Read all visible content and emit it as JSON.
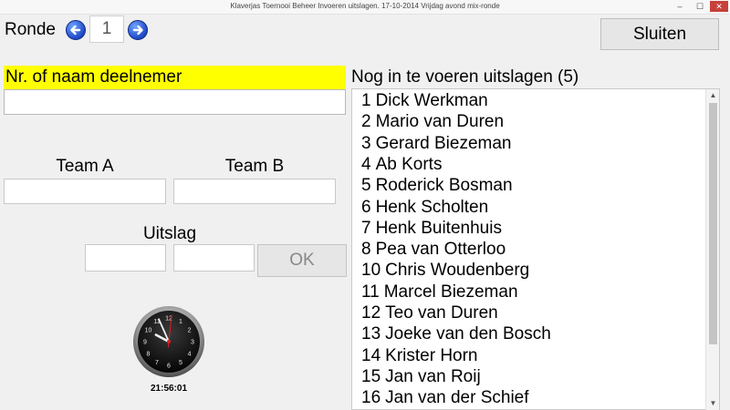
{
  "window": {
    "title": "Klaverjas Toernooi Beheer Invoeren uitslagen. 17-10-2014 Vrijdag avond mix-ronde",
    "controls": {
      "minimize": "–",
      "maximize": "☐",
      "close": "✕"
    }
  },
  "round": {
    "label": "Ronde",
    "value": "1",
    "prev_icon": "left-arrow-icon",
    "next_icon": "right-arrow-icon"
  },
  "close_button": {
    "label": "Sluiten"
  },
  "participant": {
    "label": "Nr. of naam deelnemer",
    "value": "",
    "highlight_color": "#ffff00"
  },
  "teams": {
    "team_a": {
      "label": "Team A",
      "value": ""
    },
    "team_b": {
      "label": "Team B",
      "value": ""
    }
  },
  "result": {
    "label": "Uitslag",
    "score_a": "",
    "score_b": "",
    "ok_label": "OK"
  },
  "clock": {
    "time": "21:56:01",
    "hour": 21,
    "minute": 56,
    "second": 1,
    "numerals": [
      "12",
      "1",
      "2",
      "3",
      "4",
      "5",
      "6",
      "7",
      "8",
      "9",
      "10",
      "11"
    ]
  },
  "pending": {
    "header": "Nog in te voeren uitslagen (5)",
    "items": [
      {
        "nr": "1",
        "name": "Dick Werkman"
      },
      {
        "nr": "2",
        "name": "Mario van Duren"
      },
      {
        "nr": "3",
        "name": "Gerard Biezeman"
      },
      {
        "nr": "4",
        "name": "Ab Korts"
      },
      {
        "nr": "5",
        "name": "Roderick Bosman"
      },
      {
        "nr": "6",
        "name": "Henk Scholten"
      },
      {
        "nr": "7",
        "name": "Henk Buitenhuis"
      },
      {
        "nr": "8",
        "name": "Pea van Otterloo"
      },
      {
        "nr": "10",
        "name": "Chris Woudenberg"
      },
      {
        "nr": "11",
        "name": "Marcel Biezeman"
      },
      {
        "nr": "12",
        "name": "Teo van Duren"
      },
      {
        "nr": "13",
        "name": "Joeke van den Bosch"
      },
      {
        "nr": "14",
        "name": "Krister Horn"
      },
      {
        "nr": "15",
        "name": "Jan van Roij"
      },
      {
        "nr": "16",
        "name": "Jan van der Schief"
      }
    ]
  },
  "scrollbar": {
    "up": "▲",
    "down": "▼"
  }
}
